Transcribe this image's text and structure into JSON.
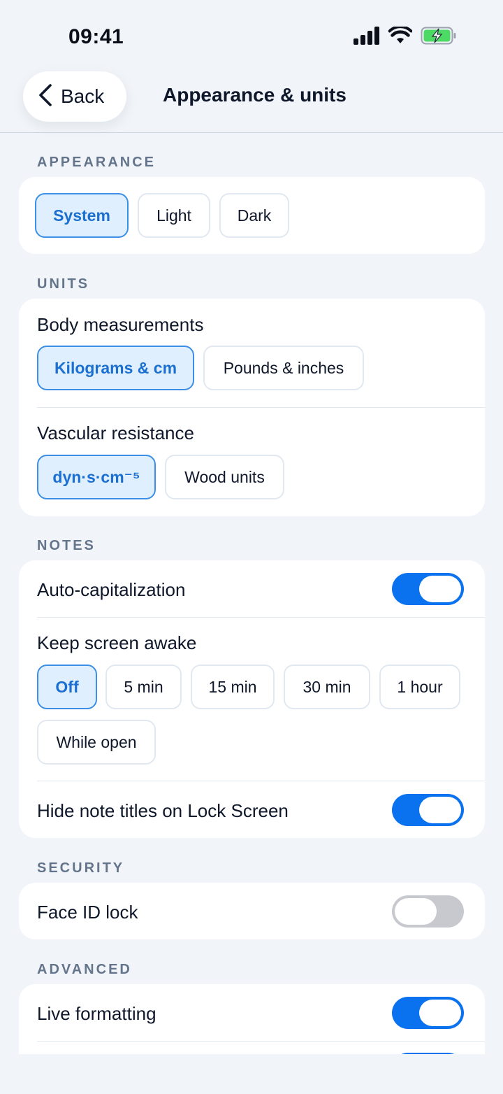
{
  "status_bar": {
    "time": "09:41"
  },
  "nav": {
    "back_label": "Back",
    "title": "Appearance & units"
  },
  "appearance": {
    "header": "APPEARANCE",
    "options": [
      "System",
      "Light",
      "Dark"
    ],
    "selected": "System"
  },
  "units": {
    "header": "UNITS",
    "body": {
      "label": "Body measurements",
      "options": [
        "Kilograms & cm",
        "Pounds & inches"
      ],
      "selected": "Kilograms & cm"
    },
    "vascular": {
      "label": "Vascular resistance",
      "options": [
        "dyn·s·cm⁻⁵",
        "Wood units"
      ],
      "selected": "dyn·s·cm⁻⁵"
    }
  },
  "notes": {
    "header": "NOTES",
    "auto_cap": {
      "label": "Auto-capitalization",
      "on": true
    },
    "keep_awake": {
      "label": "Keep screen awake",
      "options": [
        "Off",
        "5 min",
        "15 min",
        "30 min",
        "1 hour",
        "While open"
      ],
      "selected": "Off"
    },
    "hide_titles": {
      "label": "Hide note titles on Lock Screen",
      "on": true
    }
  },
  "security": {
    "header": "SECURITY",
    "face_id": {
      "label": "Face ID lock",
      "on": false
    }
  },
  "advanced": {
    "header": "ADVANCED",
    "live_formatting": {
      "label": "Live formatting",
      "on": true
    }
  },
  "colors": {
    "accent": "#0A72EE",
    "selected_bg": "#E0EFFE",
    "battery_green": "#4CD964",
    "background": "#F1F5F9"
  }
}
